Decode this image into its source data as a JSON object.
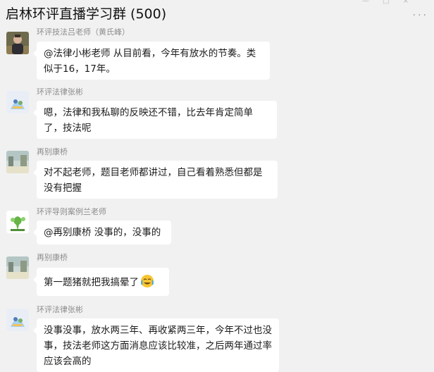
{
  "header": {
    "title": "启林环评直播学习群 (500)",
    "more_icon": "more-icon",
    "window_controls": "— □ ×"
  },
  "messages": [
    {
      "sender": "环评技法吕老师（黄氏峰）",
      "text": "@法律小彬老师 从目前看，今年有放水的节奏。类似于16，17年。",
      "avatar_icon": "person-photo-avatar"
    },
    {
      "sender": "环评法律张彬",
      "text": "嗯，法律和我私聊的反映还不错，比去年肯定简单了，技法呢",
      "avatar_icon": "cartoon-avatar"
    },
    {
      "sender": "再别康桥",
      "text": "对不起老师，题目老师都讲过，自己看着熟悉但都是没有把握",
      "avatar_icon": "scenery-avatar"
    },
    {
      "sender": "环评导则案例兰老师",
      "text": "@再别康桥 没事的，没事的",
      "avatar_icon": "plant-avatar"
    },
    {
      "sender": "再别康桥",
      "text": "第一题猪就把我搞晕了",
      "emoji": "crying-laughing-emoji",
      "avatar_icon": "scenery-avatar"
    },
    {
      "sender": "环评法律张彬",
      "text": "没事没事，放水两三年、再收紧两三年，今年不过也没事，技法老师这方面消息应该比较准，之后两年通过率应该会高的",
      "avatar_icon": "cartoon-avatar"
    }
  ]
}
